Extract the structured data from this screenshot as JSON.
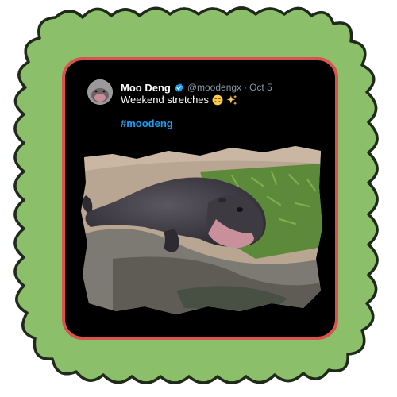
{
  "frame": {
    "leaf_color": "#8bbf6a",
    "leaf_outline": "#1f2a1a",
    "border_color": "#d9534f",
    "card_color": "#000000"
  },
  "tweet": {
    "avatar_icon": "hippo-avatar-icon",
    "display_name": "Moo Deng",
    "verified_icon": "verified-badge-icon",
    "handle": "@moodengx",
    "separator": "·",
    "date": "Oct 5",
    "text": "Weekend stretches",
    "emojis": [
      "smiling-face-emoji",
      "sparkles-emoji"
    ],
    "hashtag": "#moodeng",
    "media": "photo-baby-hippo-stretching"
  }
}
